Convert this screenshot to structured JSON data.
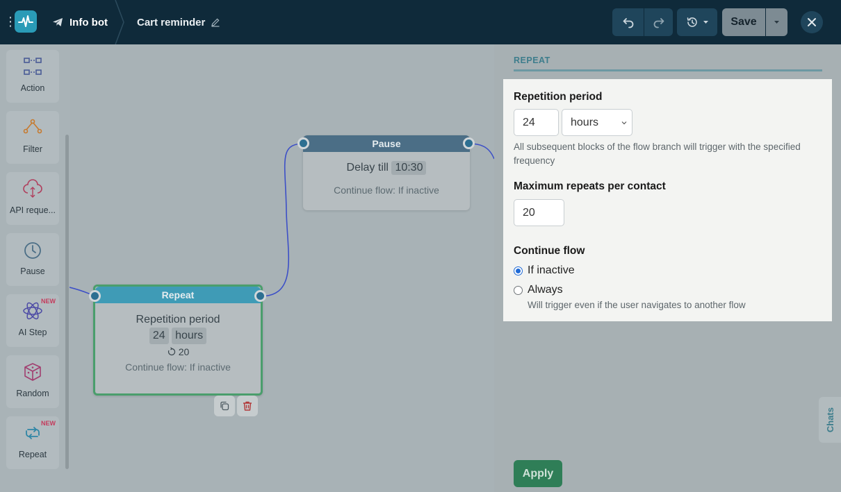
{
  "topbar": {
    "bot_name": "Info bot",
    "flow_name": "Cart reminder",
    "save_label": "Save"
  },
  "sidebar": {
    "items": [
      {
        "label": "Action",
        "icon": "action-icon",
        "badge": ""
      },
      {
        "label": "Filter",
        "icon": "filter-icon",
        "badge": ""
      },
      {
        "label": "API reque...",
        "icon": "api-request-icon",
        "badge": ""
      },
      {
        "label": "Pause",
        "icon": "clock-icon",
        "badge": ""
      },
      {
        "label": "AI Step",
        "icon": "ai-step-icon",
        "badge": "NEW"
      },
      {
        "label": "Random",
        "icon": "dice-icon",
        "badge": ""
      },
      {
        "label": "Repeat",
        "icon": "repeat-icon",
        "badge": "NEW"
      }
    ]
  },
  "canvas": {
    "pause_node": {
      "title": "Pause",
      "delay_label": "Delay till",
      "delay_time": "10:30",
      "continue_text": "Continue flow: If inactive"
    },
    "repeat_node": {
      "title": "Repeat",
      "period_label": "Repetition period",
      "period_value": "24",
      "period_unit": "hours",
      "max_repeats": "20",
      "continue_text": "Continue flow: If inactive"
    }
  },
  "panel": {
    "tab": "REPEAT",
    "repetition_period_label": "Repetition period",
    "period_value": "24",
    "period_unit": "hours",
    "period_hint": "All subsequent blocks of the flow branch will trigger with the specified frequency",
    "max_repeats_label": "Maximum repeats per contact",
    "max_repeats_value": "20",
    "continue_flow_label": "Continue flow",
    "options": [
      {
        "label": "If inactive",
        "selected": true
      },
      {
        "label": "Always",
        "selected": false
      }
    ],
    "always_hint": "Will trigger even if the user navigates to another flow",
    "apply_label": "Apply"
  },
  "chats_tab": "Chats",
  "colors": {
    "topbar": "#0f2a3a",
    "accent": "#2a9bb7",
    "apply": "#2f7e57",
    "repeat_header": "#3f9bb6",
    "pause_header": "#4b6e86"
  }
}
